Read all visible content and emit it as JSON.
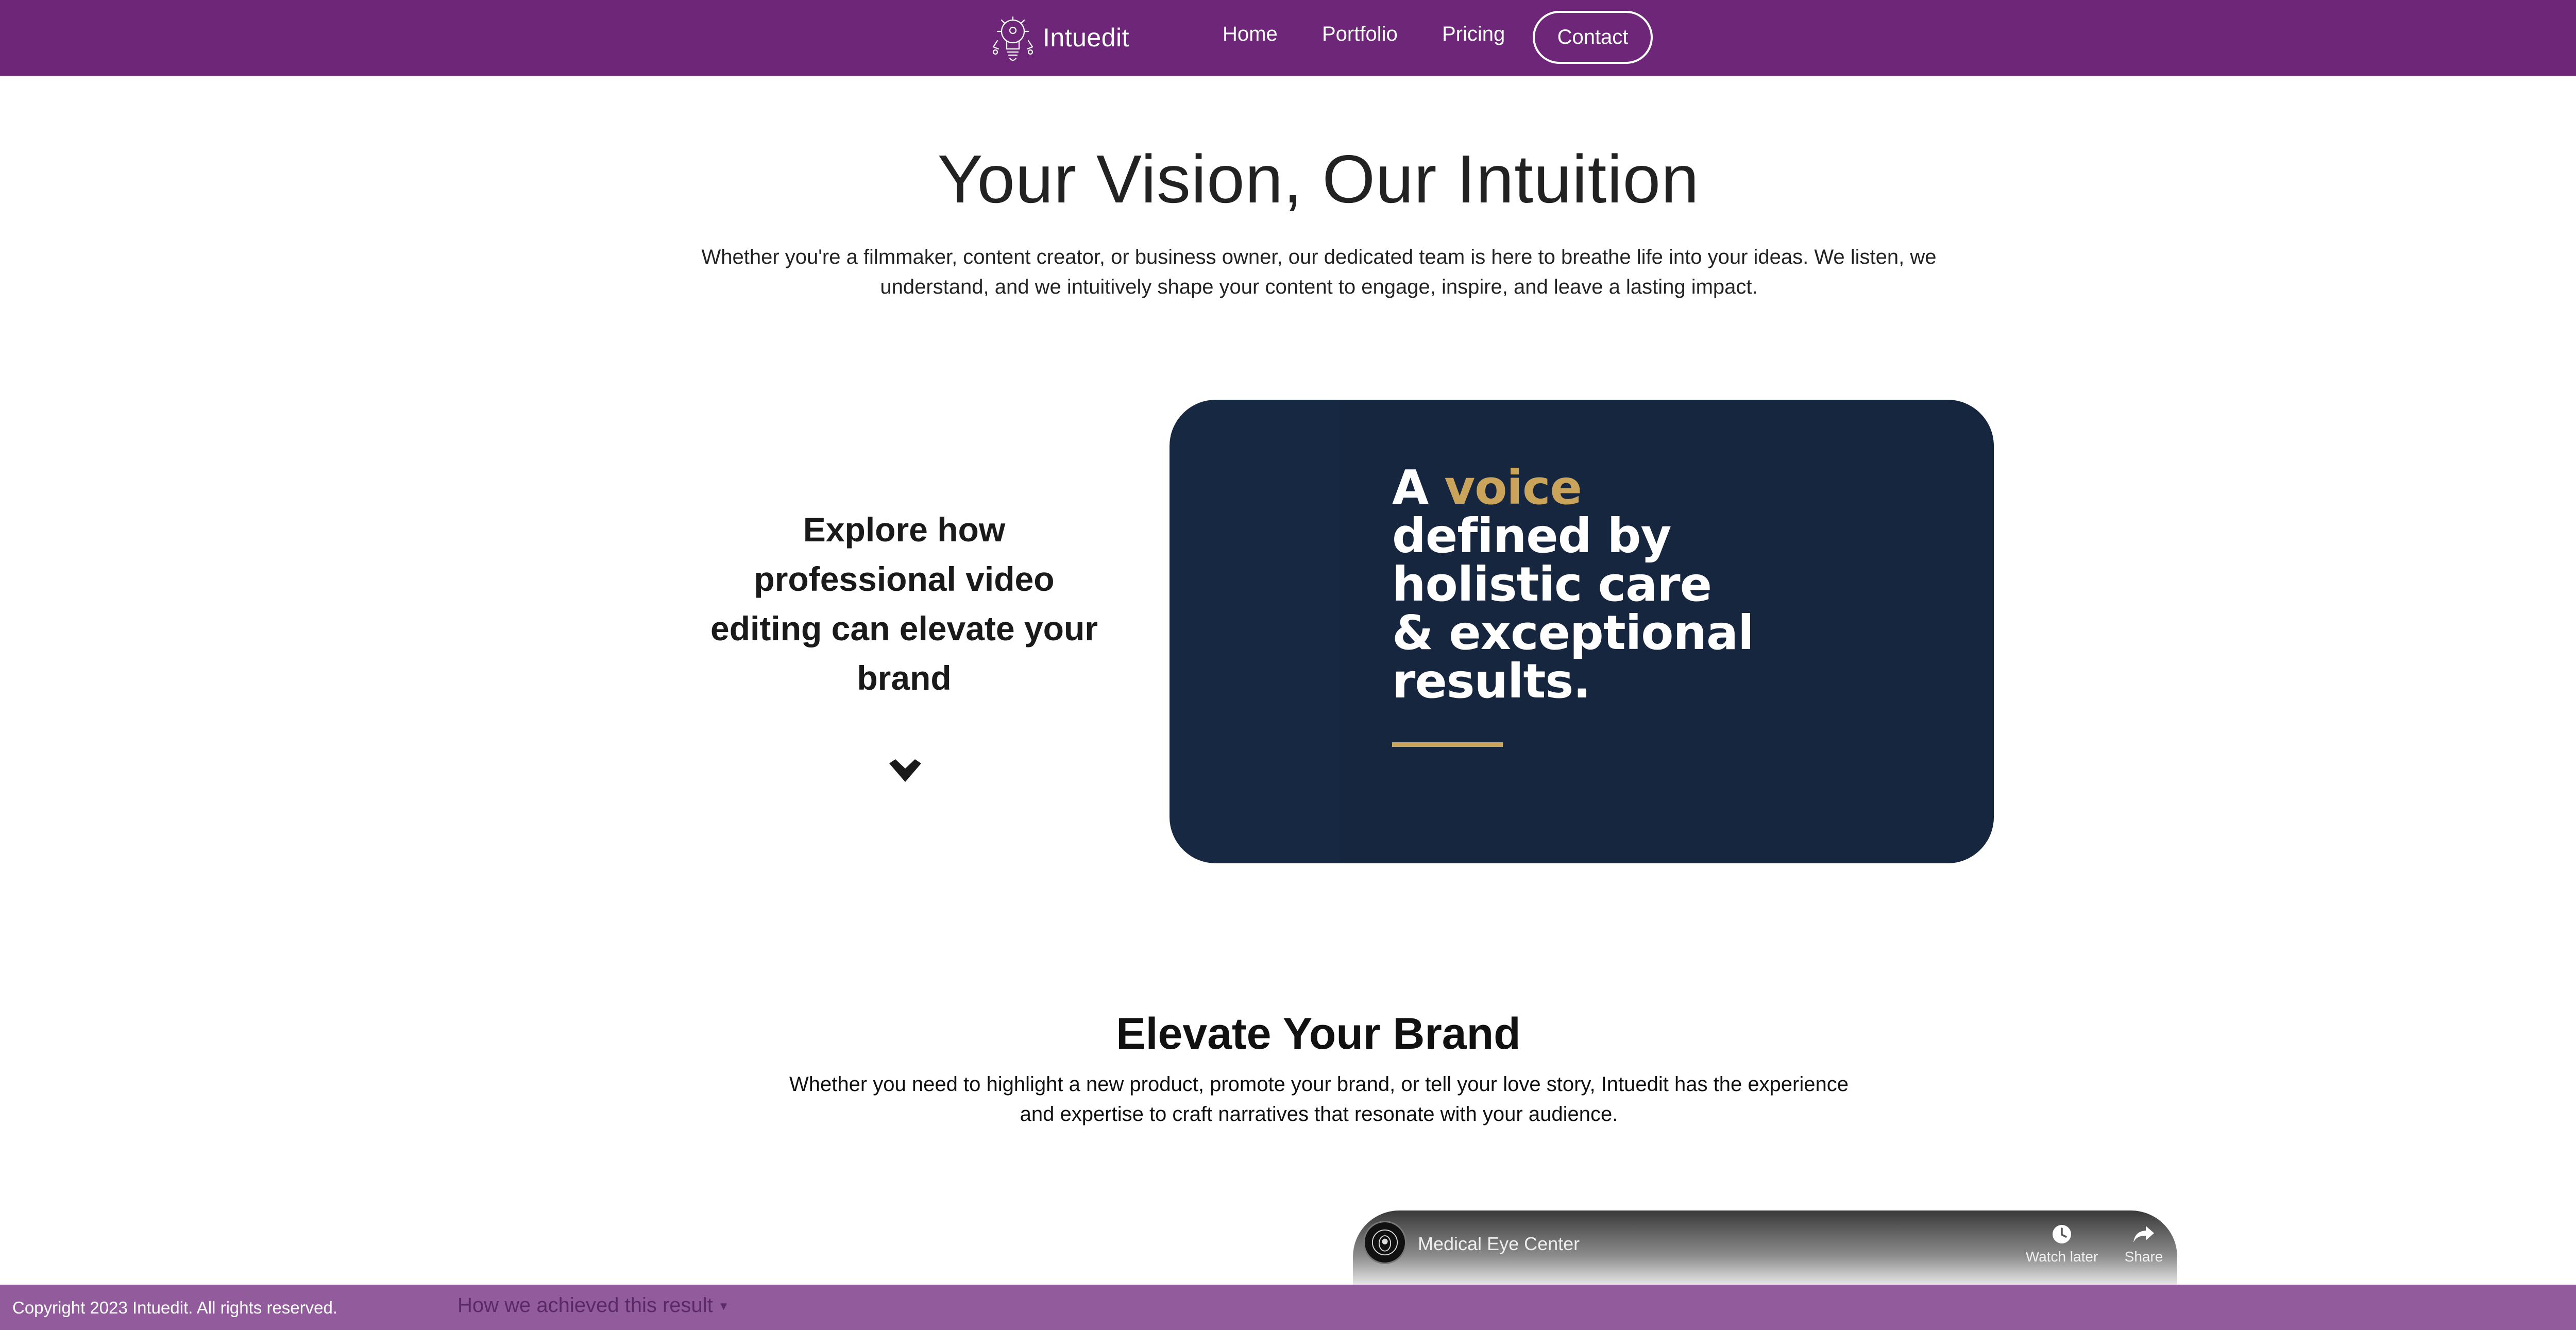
{
  "navbar": {
    "brand_name": "Intuedit",
    "brand_icon": "lightbulb-robot-logo-icon",
    "links": [
      {
        "label": "Home"
      },
      {
        "label": "Portfolio"
      },
      {
        "label": "Pricing"
      }
    ],
    "contact_label": "Contact"
  },
  "hero": {
    "title": "Your Vision, Our Intuition",
    "subtitle": "Whether you're a filmmaker, content creator, or business owner, our dedicated team is here to breathe life into your ideas. We listen, we understand, and we intuitively shape your content to engage, inspire, and leave a lasting impact."
  },
  "explore": {
    "title": "Explore how professional video editing can elevate your brand",
    "chevron_icon": "chevron-down-icon"
  },
  "voice_card": {
    "word_a": "A",
    "word_voice": "voice",
    "line_2": "defined by",
    "line_3": "holistic care",
    "line_4": "& exceptional",
    "line_5": "results."
  },
  "elevate": {
    "title": "Elevate Your Brand",
    "subtitle": "Whether you need to highlight a new product, promote your brand, or tell your love story, Intuedit has the experience and expertise to craft narratives that resonate with your audience."
  },
  "video": {
    "channel_title": "Medical Eye Center",
    "watch_later_label": "Watch later",
    "share_label": "Share"
  },
  "footer": {
    "copyright": "Copyright 2023 Intuedit. All rights reserved.",
    "how_link": "How we achieved this result",
    "how_arrow": "▼"
  },
  "colors": {
    "navbar_bg": "#6e2778",
    "footer_bg": "#925c9c",
    "card_bg": "#172843",
    "accent_gold": "#c9a45a"
  }
}
